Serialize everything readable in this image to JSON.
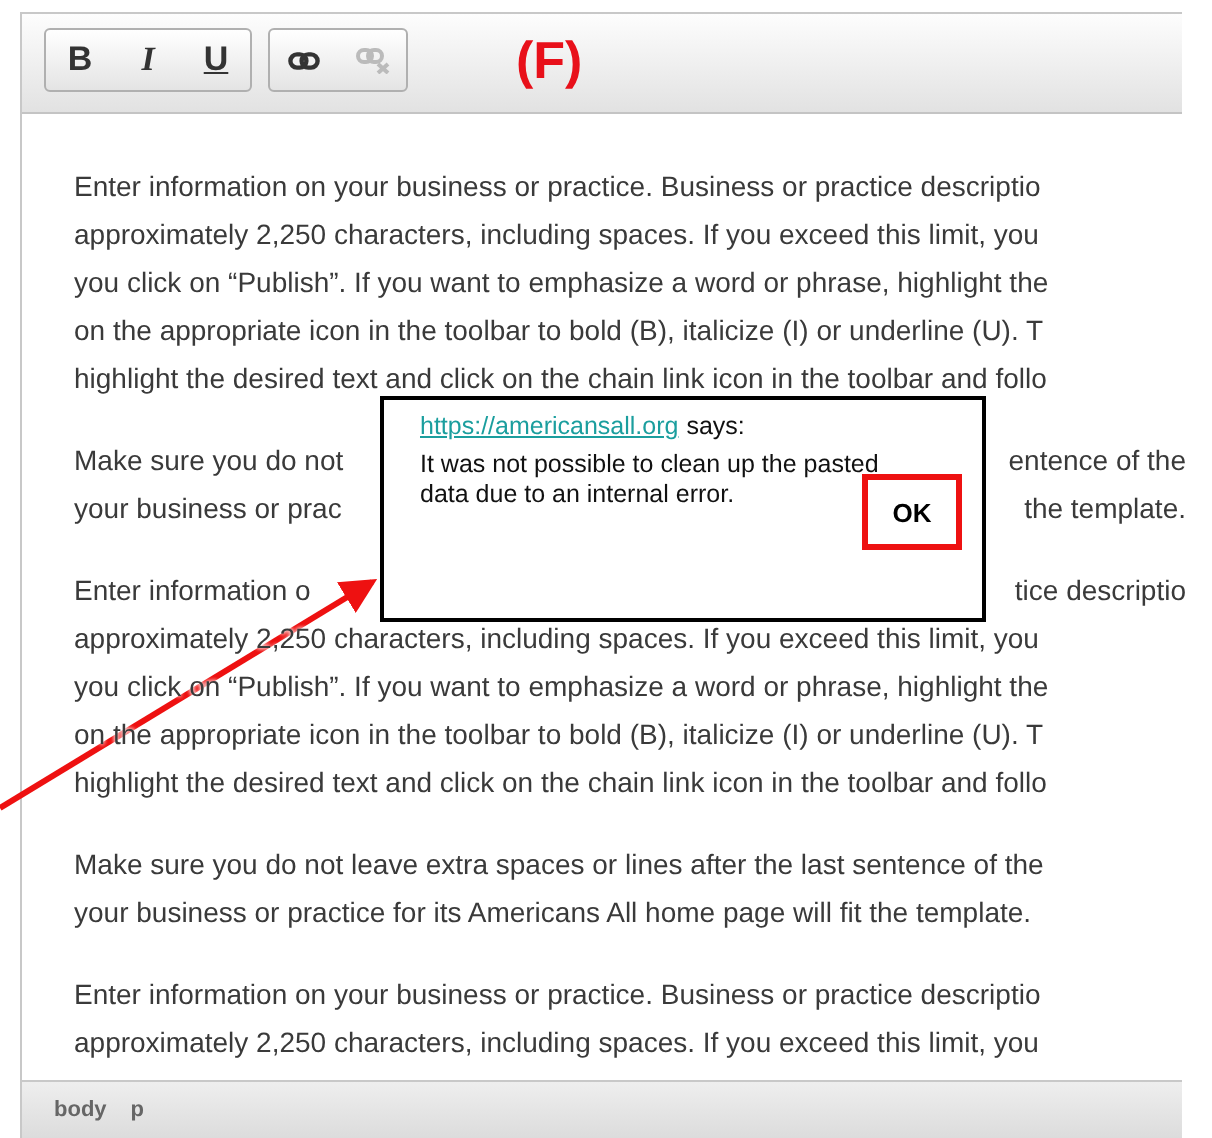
{
  "annotation_label": "(F)",
  "toolbar": {
    "groups": [
      [
        {
          "kind": "bold",
          "label": "B",
          "disabled": false
        },
        {
          "kind": "italic",
          "label": "I",
          "disabled": false
        },
        {
          "kind": "underline",
          "label": "U",
          "disabled": false
        }
      ],
      [
        {
          "kind": "link",
          "disabled": false
        },
        {
          "kind": "unlink",
          "disabled": true
        }
      ]
    ]
  },
  "content": {
    "paragraphs": [
      {
        "lines": [
          [
            "Enter information on your business or practice. Business or practice descriptio"
          ],
          [
            "approximately 2,250 characters, including spaces. If you exceed this limit, you"
          ],
          [
            "you click on “Publish”. If you want to emphasize a word or phrase, highlight the"
          ],
          [
            "on the appropriate icon in the toolbar to bold (B), italicize (I) or underline (U). T"
          ],
          [
            "highlight the desired text and click on the chain link icon in the toolbar and follo"
          ]
        ]
      },
      {
        "lines": [
          [
            "Make sure you do not",
            "entence of the"
          ],
          [
            "your business or prac",
            "the template."
          ]
        ]
      },
      {
        "lines": [
          [
            "Enter information o",
            "tice descriptio"
          ],
          [
            "approximately 2,250 characters, including spaces. If you exceed this limit, you"
          ],
          [
            "you click on “Publish”. If you want to emphasize a word or phrase, highlight the"
          ],
          [
            "on the appropriate icon in the toolbar to bold (B), italicize (I) or underline (U). T"
          ],
          [
            "highlight the desired text and click on the chain link icon in the toolbar and follo"
          ]
        ]
      },
      {
        "lines": [
          [
            "Make sure you do not leave extra spaces or lines after the last sentence of the"
          ],
          [
            "your business or practice for its Americans All home page will fit the template."
          ]
        ]
      },
      {
        "lines": [
          [
            "Enter information on your business or practice. Business or practice descriptio"
          ],
          [
            "approximately 2,250 characters, including spaces. If you exceed this limit, you"
          ]
        ]
      }
    ]
  },
  "status_bar": {
    "path": [
      "body",
      "p"
    ]
  },
  "dialog": {
    "link": "https://americansall.org",
    "says": "says:",
    "message": "It was not possible to clean up the pasted data due to an internal error.",
    "button": "OK"
  }
}
